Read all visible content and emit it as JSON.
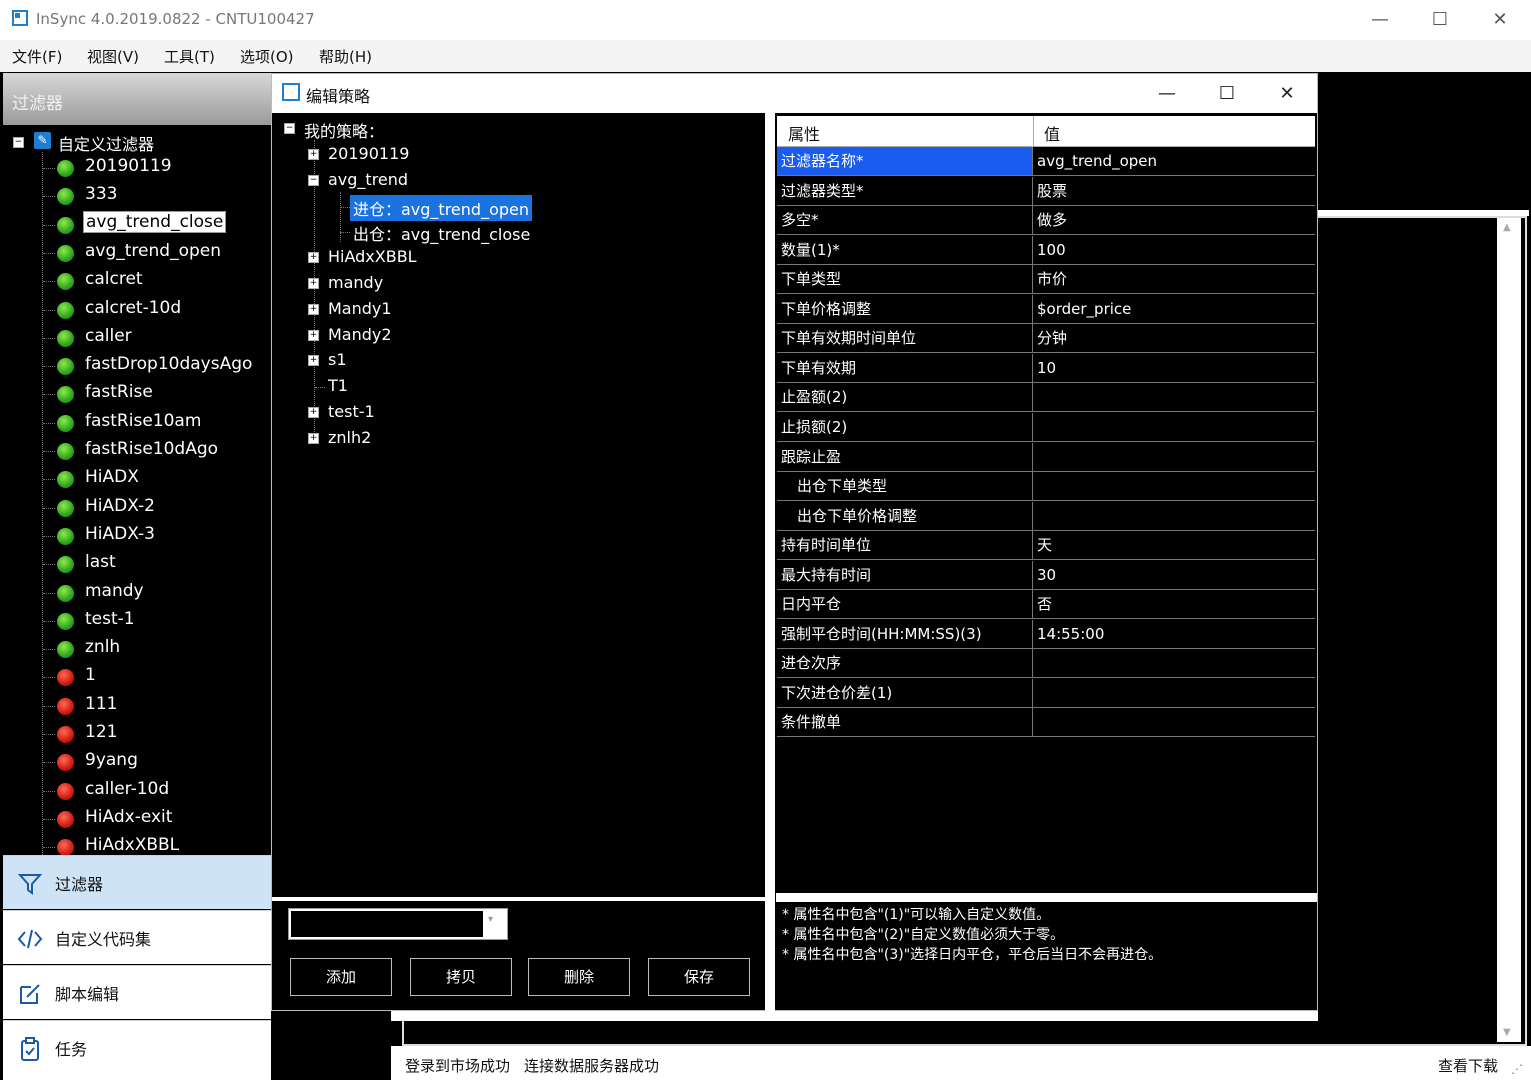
{
  "window": {
    "title": "InSync 4.0.2019.0822 - CNTU100427",
    "minimize": "—",
    "maximize": "☐",
    "close": "✕"
  },
  "menu": [
    "文件(F)",
    "视图(V)",
    "工具(T)",
    "选项(O)",
    "帮助(H)"
  ],
  "sidebar": {
    "header": "过滤器",
    "root_label": "自定义过滤器",
    "items": [
      {
        "label": "20190119",
        "status": "green"
      },
      {
        "label": "333",
        "status": "green"
      },
      {
        "label": "avg_trend_close",
        "status": "green",
        "selected": true
      },
      {
        "label": "avg_trend_open",
        "status": "green"
      },
      {
        "label": "calcret",
        "status": "green"
      },
      {
        "label": "calcret-10d",
        "status": "green"
      },
      {
        "label": "caller",
        "status": "green"
      },
      {
        "label": "fastDrop10daysAgo",
        "status": "green"
      },
      {
        "label": "fastRise",
        "status": "green"
      },
      {
        "label": "fastRise10am",
        "status": "green"
      },
      {
        "label": "fastRise10dAgo",
        "status": "green"
      },
      {
        "label": "HiADX",
        "status": "green"
      },
      {
        "label": "HiADX-2",
        "status": "green"
      },
      {
        "label": "HiADX-3",
        "status": "green"
      },
      {
        "label": "last",
        "status": "green"
      },
      {
        "label": "mandy",
        "status": "green"
      },
      {
        "label": "test-1",
        "status": "green"
      },
      {
        "label": "znlh",
        "status": "green"
      },
      {
        "label": "1",
        "status": "red"
      },
      {
        "label": "111",
        "status": "red"
      },
      {
        "label": "121",
        "status": "red"
      },
      {
        "label": "9yang",
        "status": "red"
      },
      {
        "label": "caller-10d",
        "status": "red"
      },
      {
        "label": "HiAdx-exit",
        "status": "red"
      },
      {
        "label": "HiAdxXBBL",
        "status": "red"
      }
    ],
    "nav": [
      {
        "label": "过滤器",
        "icon": "filter-icon",
        "active": true
      },
      {
        "label": "自定义代码集",
        "icon": "code-icon",
        "active": false
      },
      {
        "label": "脚本编辑",
        "icon": "edit-icon",
        "active": false
      },
      {
        "label": "任务",
        "icon": "task-icon",
        "active": false
      }
    ]
  },
  "dialog": {
    "title": "编辑策略",
    "minimize": "—",
    "maximize": "☐",
    "close": "✕",
    "tree": {
      "root": "我的策略：",
      "nodes": [
        {
          "label": "20190119",
          "expander": "+"
        },
        {
          "label": "avg_trend",
          "expander": "−"
        },
        {
          "label": "进仓：avg_trend_open",
          "child": true,
          "selected": true
        },
        {
          "label": "出仓：avg_trend_close",
          "child": true
        },
        {
          "label": "HiAdxXBBL",
          "expander": "+"
        },
        {
          "label": "mandy",
          "expander": "+"
        },
        {
          "label": "Mandy1",
          "expander": "+"
        },
        {
          "label": "Mandy2",
          "expander": "+"
        },
        {
          "label": "s1",
          "expander": "+"
        },
        {
          "label": "T1",
          "expander": ""
        },
        {
          "label": "test-1",
          "expander": "+"
        },
        {
          "label": "znlh2",
          "expander": "+"
        }
      ]
    },
    "combo_value": "",
    "combo_arrow": "▾",
    "buttons": {
      "add": "添加",
      "copy": "拷贝",
      "delete": "删除",
      "save": "保存"
    },
    "properties": {
      "header_name": "属性",
      "header_value": "值",
      "rows": [
        {
          "name": "过滤器名称*",
          "value": "avg_trend_open",
          "selected": true
        },
        {
          "name": "过滤器类型*",
          "value": "股票"
        },
        {
          "name": "多空*",
          "value": "做多"
        },
        {
          "name": "数量(1)*",
          "value": "100"
        },
        {
          "name": "下单类型",
          "value": "市价"
        },
        {
          "name": "下单价格调整",
          "value": "$order_price"
        },
        {
          "name": "下单有效期时间单位",
          "value": "分钟"
        },
        {
          "name": "下单有效期",
          "value": "10"
        },
        {
          "name": "止盈额(2)",
          "value": ""
        },
        {
          "name": "止损额(2)",
          "value": ""
        },
        {
          "name": "跟踪止盈",
          "value": ""
        },
        {
          "name": "出仓下单类型",
          "value": "",
          "indent": true
        },
        {
          "name": "出仓下单价格调整",
          "value": "",
          "indent": true
        },
        {
          "name": "持有时间单位",
          "value": "天"
        },
        {
          "name": "最大持有时间",
          "value": "30"
        },
        {
          "name": "日内平仓",
          "value": "否"
        },
        {
          "name": "强制平仓时间(HH:MM:SS)(3)",
          "value": "14:55:00"
        },
        {
          "name": "进仓次序",
          "value": ""
        },
        {
          "name": "下次进仓价差(1)",
          "value": ""
        },
        {
          "name": "条件撤单",
          "value": ""
        }
      ]
    },
    "notes": [
      "* 属性名中包含\"(1)\"可以输入自定义数值。",
      "* 属性名中包含\"(2)\"自定义数值必须大于零。",
      "* 属性名中包含\"(3)\"选择日内平仓，平仓后当日不会再进仓。"
    ]
  },
  "status": {
    "market": "登录到市场成功",
    "data_server": "连接数据服务器成功",
    "download": "查看下载"
  },
  "colors": {
    "accent": "#1a73e0",
    "selected_prop": "#1a5cf0",
    "green": "#2da51b",
    "red": "#d01a10",
    "nav_active": "#cfe3f6"
  }
}
